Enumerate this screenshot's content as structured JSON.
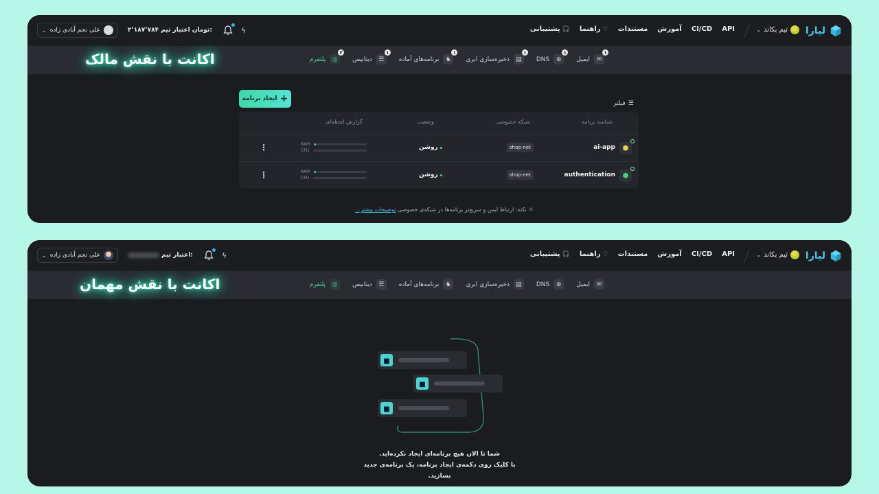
{
  "panels": [
    {
      "logo_text": "لیارا",
      "team_name": "تیم بکاند",
      "nav": {
        "support": "پشتیبانی",
        "guide": "راهنما",
        "docs": "مستندات",
        "learn": "آموزش",
        "cicd": "CI/CD",
        "api": "API"
      },
      "user_name": "علی نجم آبادی زاده",
      "credit_label": "اعتبار تیم:",
      "credit_value": "۲٬۱۸۷٬۷۸۴ تومان",
      "tabs": [
        {
          "label": "پلتفرم",
          "badge": "۲",
          "active": true,
          "icon": "platform-icon"
        },
        {
          "label": "دیتابیس",
          "badge": "۱",
          "active": false,
          "icon": "database-icon"
        },
        {
          "label": "برنامه‌های آماده",
          "badge": "۱",
          "active": false,
          "icon": "ready-apps-icon"
        },
        {
          "label": "ذخیره‌سازی ابری",
          "badge": "۱",
          "active": false,
          "icon": "storage-icon"
        },
        {
          "label": "DNS",
          "badge": "۱",
          "active": false,
          "icon": "globe-icon"
        },
        {
          "label": "ایمیل",
          "badge": "۱",
          "active": false,
          "icon": "mail-icon"
        }
      ],
      "role_title": "اکانت با نقش مالک",
      "create_button": "ایجاد برنامه",
      "filter_label": "فیلتر",
      "table": {
        "headers": {
          "app_id": "شناسه برنامه",
          "private_net": "شبکه خصوصی",
          "status": "وضعیت",
          "report": "گزارش لحظه‌ای"
        },
        "rows": [
          {
            "name": "ai-app",
            "network": "shop-net",
            "status": "روشن",
            "ram_label": "RAM",
            "cpu_label": "CPU",
            "ram": 0.04,
            "cpu": 0.0
          },
          {
            "name": "authentication",
            "network": "shop-net",
            "status": "روشن",
            "ram_label": "RAM",
            "cpu_label": "CPU",
            "ram": 0.04,
            "cpu": 0.0
          }
        ]
      },
      "note_prefix": "نکته:",
      "note_text": "ارتباط ایمن و سریع‌تر برنامه‌ها در شبکه‌ی خصوصی",
      "note_link": "توضیحات بیشتر..."
    },
    {
      "logo_text": "لیارا",
      "team_name": "تیم بکاند",
      "nav": {
        "support": "پشتیبانی",
        "guide": "راهنما",
        "docs": "مستندات",
        "learn": "آموزش",
        "cicd": "CI/CD",
        "api": "API"
      },
      "user_name": "علی نجم آبادی زاده",
      "credit_label": "اعتبار تیم:",
      "tabs": [
        {
          "label": "پلتفرم",
          "active": true,
          "icon": "platform-icon"
        },
        {
          "label": "دیتابیس",
          "active": false,
          "icon": "database-icon"
        },
        {
          "label": "برنامه‌های آماده",
          "active": false,
          "icon": "ready-apps-icon"
        },
        {
          "label": "ذخیره‌سازی ابری",
          "active": false,
          "icon": "storage-icon"
        },
        {
          "label": "DNS",
          "active": false,
          "icon": "globe-icon"
        },
        {
          "label": "ایمیل",
          "active": false,
          "icon": "mail-icon"
        }
      ],
      "role_title": "اکانت با نقش مهمان",
      "empty_line1": "شما تا الان هیچ برنامه‌ای ایجاد نکرده‌اید.",
      "empty_line2": "با کلیک روی دکمه‌ی ایجاد برنامه، یک برنامه‌ی جدید",
      "empty_line3": "بسازید."
    }
  ],
  "colors": {
    "page_bg": "#b6f7e8",
    "panel_bg": "#1b1c20",
    "accent": "#3fd7a5",
    "brand": "#49c9e9"
  }
}
